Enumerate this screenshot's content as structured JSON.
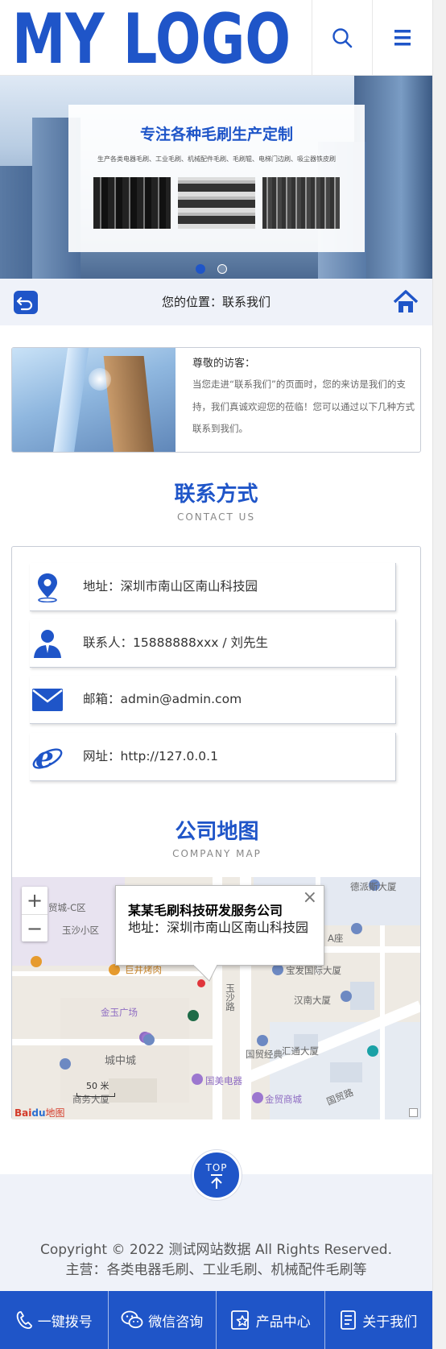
{
  "header": {
    "logo_text": "MY LOGO",
    "search_icon": "search-icon",
    "menu_icon": "menu-icon"
  },
  "banner": {
    "title": "专注各种毛刷生产定制",
    "subtitle": "生产各类电器毛刷、工业毛刷、机械配件毛刷、毛刷辊、电梯门边刷、吸尘器铁皮刷",
    "active_slide": 1,
    "slide_count": 2
  },
  "location": {
    "text": "您的位置：联系我们"
  },
  "intro": {
    "title": "尊敬的访客：",
    "text": "当您走进“联系我们”的页面时，您的来访是我们的支持，我们真诚欢迎您的莅临！您可以通过以下几种方式联系到我们。"
  },
  "contact_section": {
    "title": "联系方式",
    "subtitle": "CONTACT US",
    "rows": [
      {
        "icon": "location-pin-icon",
        "label": "地址：深圳市南山区南山科技园"
      },
      {
        "icon": "person-icon",
        "label": "联系人：15888888xxx / 刘先生"
      },
      {
        "icon": "mail-icon",
        "label": "邮箱：admin@admin.com"
      },
      {
        "icon": "ie-browser-icon",
        "label": "网址：http://127.0.0.1"
      }
    ]
  },
  "map_section": {
    "title": "公司地图",
    "subtitle": "COMPANY MAP",
    "popup_title": "某某毛刷科技研发服务公司",
    "popup_address": "地址：深圳市南山区南山科技园",
    "zoom_in": "+",
    "zoom_out": "−",
    "scale": "50 米",
    "labels": {
      "yusha": "玉沙小区",
      "juyi": "巨井烤肉",
      "jinyu": "金玉广场",
      "chengzhong": "城中城",
      "baofa": "宝发国际大厦",
      "hanshang": "汉南大厦",
      "guojing": "国贸经典",
      "huitong": "汇通大厦",
      "guomei": "国美电器",
      "jinmao": "金贸商城",
      "guomao_rd": "国贸路",
      "yusha_rd": "玉沙路",
      "pai": "德派斯大厦",
      "mao": "贸城-C区",
      "a_zuo": "A座",
      "shangwu": "商务大厦"
    }
  },
  "top_button": {
    "label": "TOP"
  },
  "footer": {
    "copyright": "Copyright © 2022 测试网站数据 All Rights Reserved.",
    "business": "主营：各类电器毛刷、工业毛刷、机械配件毛刷等"
  },
  "bottom_nav": [
    {
      "icon": "phone-icon",
      "label": "一键拨号"
    },
    {
      "icon": "wechat-icon",
      "label": "微信咨询"
    },
    {
      "icon": "product-icon",
      "label": "产品中心"
    },
    {
      "icon": "about-icon",
      "label": "关于我们"
    }
  ],
  "colors": {
    "brand": "#1f55c8",
    "footer_bg": "#eff2f9"
  }
}
